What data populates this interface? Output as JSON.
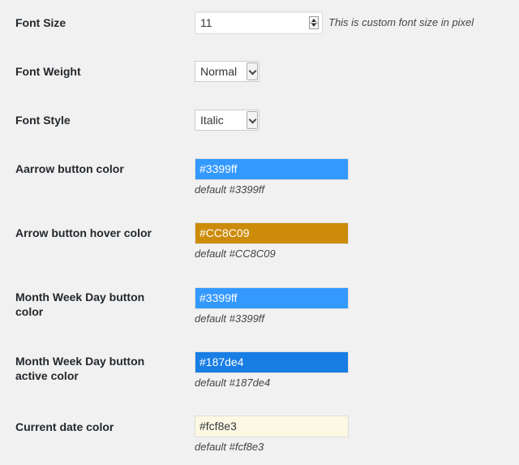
{
  "font_size": {
    "label": "Font Size",
    "value": "11",
    "hint": "This is custom font size in pixel"
  },
  "font_weight": {
    "label": "Font Weight",
    "selected": "Normal"
  },
  "font_style": {
    "label": "Font Style",
    "selected": "Italic"
  },
  "arrow_color": {
    "label": "Aarrow button color",
    "value": "#3399ff",
    "swatch": "#3399ff",
    "default": "default #3399ff"
  },
  "arrow_hover_color": {
    "label": "Arrow button hover color",
    "value": "#CC8C09",
    "swatch": "#CC8C09",
    "default": "default #CC8C09"
  },
  "mwd_color": {
    "label": "Month Week Day button color",
    "value": "#3399ff",
    "swatch": "#3399ff",
    "default": "default #3399ff"
  },
  "mwd_active_color": {
    "label": "Month Week Day button active color",
    "value": "#187de4",
    "swatch": "#187de4",
    "default": "default #187de4"
  },
  "current_date_color": {
    "label": "Current date color",
    "value": "#fcf8e3",
    "swatch": "#fcf8e3",
    "default": "default #fcf8e3"
  }
}
